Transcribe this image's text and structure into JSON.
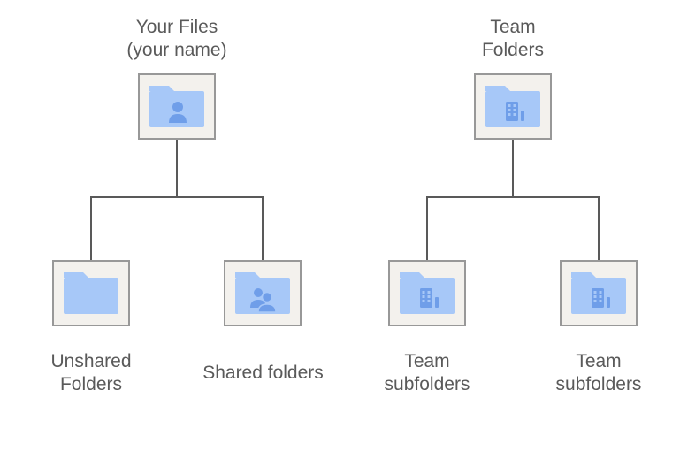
{
  "left": {
    "rootLabel": "Your Files\n(your name)",
    "child1Label": "Unshared\nFolders",
    "child2Label": "Shared folders"
  },
  "right": {
    "rootLabel": "Team\nFolders",
    "child1Label": "Team\nsubfolders",
    "child2Label": "Team\nsubfolders"
  },
  "icons": {
    "person": "person-folder",
    "blank": "blank-folder",
    "group": "group-folder",
    "team": "team-folder"
  }
}
